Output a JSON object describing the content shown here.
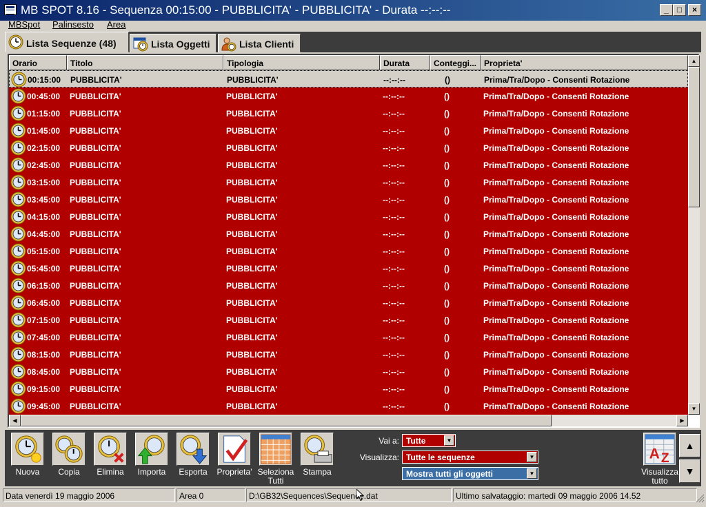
{
  "window": {
    "title": "MB SPOT 8.16 - Sequenza 00:15:00 - PUBBLICITA' - PUBBLICITA' - Durata --:--:--",
    "minimize": "_",
    "maximize": "□",
    "close": "×"
  },
  "menu": [
    "MBSpot",
    "Palinsesto",
    "Area"
  ],
  "tabs": [
    {
      "label": "Lista Sequenze (48)",
      "icon": "clock-icon",
      "active": true
    },
    {
      "label": "Lista Oggetti",
      "icon": "calendar-clock-icon",
      "active": false
    },
    {
      "label": "Lista Clienti",
      "icon": "person-clock-icon",
      "active": false
    }
  ],
  "table": {
    "columns": [
      "Orario",
      "Titolo",
      "Tipologia",
      "Durata",
      "Conteggi...",
      "Proprieta'"
    ],
    "rows": [
      {
        "orario": "00:15:00",
        "titolo": "PUBBLICITA'",
        "tipologia": "PUBBLICITA'",
        "durata": "--:--:--",
        "conteggi": "()",
        "proprieta": "Prima/Tra/Dopo - Consenti Rotazione",
        "selected": true
      },
      {
        "orario": "00:45:00",
        "titolo": "PUBBLICITA'",
        "tipologia": "PUBBLICITA'",
        "durata": "--:--:--",
        "conteggi": "()",
        "proprieta": "Prima/Tra/Dopo - Consenti Rotazione"
      },
      {
        "orario": "01:15:00",
        "titolo": "PUBBLICITA'",
        "tipologia": "PUBBLICITA'",
        "durata": "--:--:--",
        "conteggi": "()",
        "proprieta": "Prima/Tra/Dopo - Consenti Rotazione"
      },
      {
        "orario": "01:45:00",
        "titolo": "PUBBLICITA'",
        "tipologia": "PUBBLICITA'",
        "durata": "--:--:--",
        "conteggi": "()",
        "proprieta": "Prima/Tra/Dopo - Consenti Rotazione"
      },
      {
        "orario": "02:15:00",
        "titolo": "PUBBLICITA'",
        "tipologia": "PUBBLICITA'",
        "durata": "--:--:--",
        "conteggi": "()",
        "proprieta": "Prima/Tra/Dopo - Consenti Rotazione"
      },
      {
        "orario": "02:45:00",
        "titolo": "PUBBLICITA'",
        "tipologia": "PUBBLICITA'",
        "durata": "--:--:--",
        "conteggi": "()",
        "proprieta": "Prima/Tra/Dopo - Consenti Rotazione"
      },
      {
        "orario": "03:15:00",
        "titolo": "PUBBLICITA'",
        "tipologia": "PUBBLICITA'",
        "durata": "--:--:--",
        "conteggi": "()",
        "proprieta": "Prima/Tra/Dopo - Consenti Rotazione"
      },
      {
        "orario": "03:45:00",
        "titolo": "PUBBLICITA'",
        "tipologia": "PUBBLICITA'",
        "durata": "--:--:--",
        "conteggi": "()",
        "proprieta": "Prima/Tra/Dopo - Consenti Rotazione"
      },
      {
        "orario": "04:15:00",
        "titolo": "PUBBLICITA'",
        "tipologia": "PUBBLICITA'",
        "durata": "--:--:--",
        "conteggi": "()",
        "proprieta": "Prima/Tra/Dopo - Consenti Rotazione"
      },
      {
        "orario": "04:45:00",
        "titolo": "PUBBLICITA'",
        "tipologia": "PUBBLICITA'",
        "durata": "--:--:--",
        "conteggi": "()",
        "proprieta": "Prima/Tra/Dopo - Consenti Rotazione"
      },
      {
        "orario": "05:15:00",
        "titolo": "PUBBLICITA'",
        "tipologia": "PUBBLICITA'",
        "durata": "--:--:--",
        "conteggi": "()",
        "proprieta": "Prima/Tra/Dopo - Consenti Rotazione"
      },
      {
        "orario": "05:45:00",
        "titolo": "PUBBLICITA'",
        "tipologia": "PUBBLICITA'",
        "durata": "--:--:--",
        "conteggi": "()",
        "proprieta": "Prima/Tra/Dopo - Consenti Rotazione"
      },
      {
        "orario": "06:15:00",
        "titolo": "PUBBLICITA'",
        "tipologia": "PUBBLICITA'",
        "durata": "--:--:--",
        "conteggi": "()",
        "proprieta": "Prima/Tra/Dopo - Consenti Rotazione"
      },
      {
        "orario": "06:45:00",
        "titolo": "PUBBLICITA'",
        "tipologia": "PUBBLICITA'",
        "durata": "--:--:--",
        "conteggi": "()",
        "proprieta": "Prima/Tra/Dopo - Consenti Rotazione"
      },
      {
        "orario": "07:15:00",
        "titolo": "PUBBLICITA'",
        "tipologia": "PUBBLICITA'",
        "durata": "--:--:--",
        "conteggi": "()",
        "proprieta": "Prima/Tra/Dopo - Consenti Rotazione"
      },
      {
        "orario": "07:45:00",
        "titolo": "PUBBLICITA'",
        "tipologia": "PUBBLICITA'",
        "durata": "--:--:--",
        "conteggi": "()",
        "proprieta": "Prima/Tra/Dopo - Consenti Rotazione"
      },
      {
        "orario": "08:15:00",
        "titolo": "PUBBLICITA'",
        "tipologia": "PUBBLICITA'",
        "durata": "--:--:--",
        "conteggi": "()",
        "proprieta": "Prima/Tra/Dopo - Consenti Rotazione"
      },
      {
        "orario": "08:45:00",
        "titolo": "PUBBLICITA'",
        "tipologia": "PUBBLICITA'",
        "durata": "--:--:--",
        "conteggi": "()",
        "proprieta": "Prima/Tra/Dopo - Consenti Rotazione"
      },
      {
        "orario": "09:15:00",
        "titolo": "PUBBLICITA'",
        "tipologia": "PUBBLICITA'",
        "durata": "--:--:--",
        "conteggi": "()",
        "proprieta": "Prima/Tra/Dopo - Consenti Rotazione"
      },
      {
        "orario": "09:45:00",
        "titolo": "PUBBLICITA'",
        "tipologia": "PUBBLICITA'",
        "durata": "--:--:--",
        "conteggi": "()",
        "proprieta": "Prima/Tra/Dopo - Consenti Rotazione"
      }
    ]
  },
  "toolbar": {
    "buttons": [
      {
        "label": "Nuova",
        "icon": "clock-new-icon"
      },
      {
        "label": "Copia",
        "icon": "clock-copy-icon"
      },
      {
        "label": "Elimina",
        "icon": "clock-delete-icon"
      },
      {
        "label": "Importa",
        "icon": "clock-import-icon"
      },
      {
        "label": "Esporta",
        "icon": "clock-export-icon"
      },
      {
        "label": "Proprieta'",
        "icon": "properties-check-icon"
      },
      {
        "label": "Seleziona Tutti",
        "icon": "select-all-grid-icon"
      },
      {
        "label": "Stampa",
        "icon": "clock-print-icon"
      }
    ],
    "vai_a_label": "Vai a:",
    "vai_a_value": "Tutte",
    "visualizza_label": "Visualizza:",
    "visualizza_value": "Tutte le sequenze",
    "oggetti_value": "Mostra tutti gli oggetti",
    "visualizza_tutto_label": "Visualizza tutto",
    "visualizza_tutto_icon": "sort-az-icon",
    "up_icon": "arrow-up-icon",
    "down_icon": "arrow-down-icon"
  },
  "status": {
    "date": "Data venerdì 19 maggio 2006",
    "area": "Area 0",
    "path": "D:\\GB32\\Sequences\\Sequence.dat",
    "saved": "Ultimo salvataggio: martedì 09 maggio 2006 14.52"
  },
  "colors": {
    "row_red": "#b00000",
    "dropdown_red": "#b00000",
    "dropdown_blue": "#3a6ea5",
    "toolbar_bg": "#3c3c3c",
    "title_blue": "#0a246a"
  }
}
